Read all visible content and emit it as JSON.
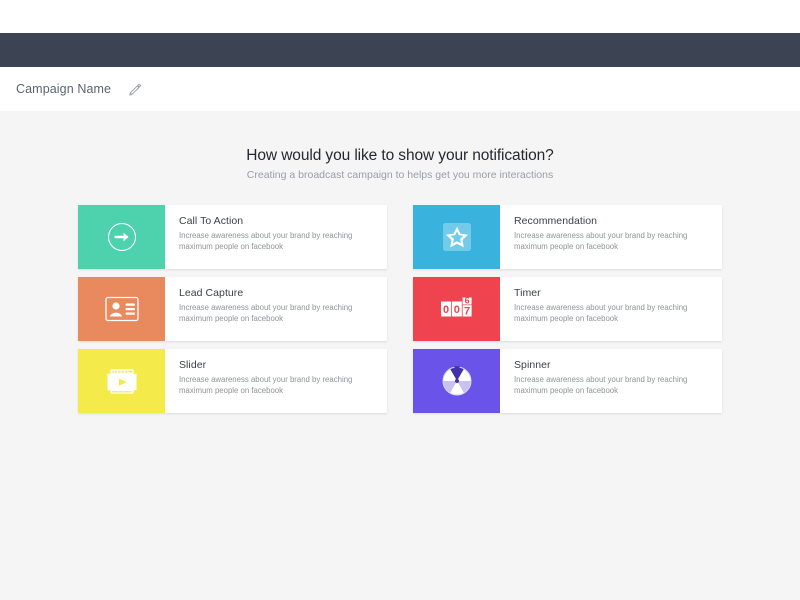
{
  "topbar": {
    "name": "app-toolbar",
    "color": "#3c4454"
  },
  "namebar": {
    "campaign_name": "Campaign Name",
    "edit_icon": "pencil-icon"
  },
  "main": {
    "heading": "How would you like to show your notification?",
    "subheading": "Creating a broadcast campaign to helps get you more interactions",
    "cards": [
      {
        "title": "Call To Action",
        "description": "Increase awareness about your brand by reaching maximum people on facebook",
        "tile_color": "#4ed2ae",
        "icon": "circle-arrow-right-icon"
      },
      {
        "title": "Recommendation",
        "description": "Increase awareness about your brand by reaching maximum people on facebook",
        "tile_color": "#39b2dd",
        "icon": "star-icon"
      },
      {
        "title": "Lead Capture",
        "description": "Increase awareness about your brand by reaching maximum people on facebook",
        "tile_color": "#e8895e",
        "icon": "id-card-icon"
      },
      {
        "title": "Timer",
        "description": "Increase awareness about your brand by reaching maximum people on facebook",
        "tile_color": "#ef4450",
        "icon": "flip-counter-icon",
        "counter_digits": [
          "0",
          "0",
          "7"
        ]
      },
      {
        "title": "Slider",
        "description": "Increase awareness about your brand by reaching maximum people on facebook",
        "tile_color": "#f4ea4a",
        "icon": "slider-play-icon"
      },
      {
        "title": "Spinner",
        "description": "Increase awareness about your brand by reaching maximum people on facebook",
        "tile_color": "#6a53e8",
        "icon": "spinner-wheel-icon"
      }
    ]
  }
}
